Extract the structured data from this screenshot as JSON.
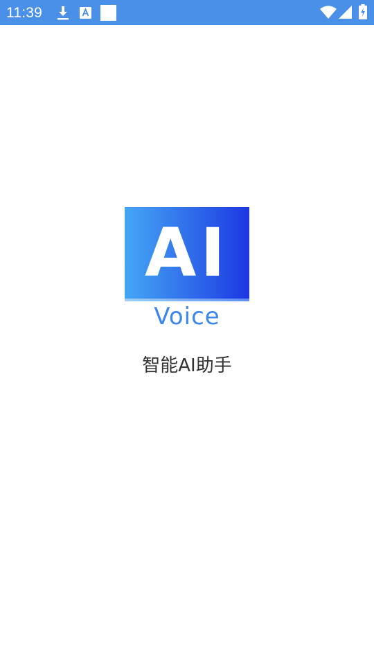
{
  "status_bar": {
    "time": "11:39",
    "background": "#4a90e8",
    "left_icons": [
      "download-icon",
      "a-letter-notification-icon",
      "blank-notification-icon"
    ],
    "right_icons": [
      "wifi-icon",
      "cellular-signal-icon",
      "battery-charging-icon"
    ]
  },
  "splash": {
    "logo_ai_text": "AI",
    "logo_voice_text": "Voice",
    "app_name": "智能AI助手",
    "logo_gradient": [
      "#44a6f5",
      "#1d37e2"
    ],
    "voice_color": "#3b86ee"
  }
}
